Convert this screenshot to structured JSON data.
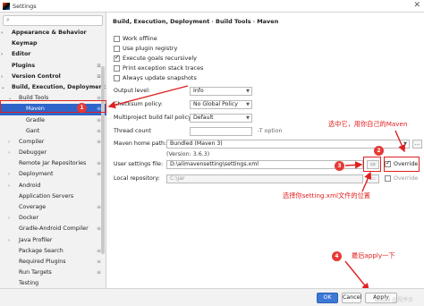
{
  "window": {
    "title": "Settings"
  },
  "search": {
    "placeholder": ""
  },
  "tree": [
    {
      "label": "Appearance & Behavior",
      "bold": true,
      "indent": 0,
      "arrow": "›"
    },
    {
      "label": "Keymap",
      "bold": true,
      "indent": 0,
      "arrow": ""
    },
    {
      "label": "Editor",
      "bold": true,
      "indent": 0,
      "arrow": "›"
    },
    {
      "label": "Plugins",
      "bold": true,
      "indent": 0,
      "arrow": "",
      "cfg": "≡"
    },
    {
      "label": "Version Control",
      "bold": true,
      "indent": 0,
      "arrow": "›",
      "cfg": "≡"
    },
    {
      "label": "Build, Execution, Deployment",
      "bold": true,
      "indent": 0,
      "arrow": "⌄"
    },
    {
      "label": "Build Tools",
      "bold": false,
      "indent": 1,
      "arrow": "⌄",
      "cfg": "≡"
    },
    {
      "label": "Maven",
      "bold": false,
      "indent": 2,
      "arrow": "›",
      "cfg": "≡",
      "selected": true
    },
    {
      "label": "Gradle",
      "bold": false,
      "indent": 2,
      "arrow": "",
      "cfg": "≡"
    },
    {
      "label": "Gant",
      "bold": false,
      "indent": 2,
      "arrow": "",
      "cfg": "≡"
    },
    {
      "label": "Compiler",
      "bold": false,
      "indent": 1,
      "arrow": "›",
      "cfg": "≡"
    },
    {
      "label": "Debugger",
      "bold": false,
      "indent": 1,
      "arrow": "›"
    },
    {
      "label": "Remote Jar Repositories",
      "bold": false,
      "indent": 1,
      "arrow": "",
      "cfg": "≡"
    },
    {
      "label": "Deployment",
      "bold": false,
      "indent": 1,
      "arrow": "›",
      "cfg": "≡"
    },
    {
      "label": "Android",
      "bold": false,
      "indent": 1,
      "arrow": "›"
    },
    {
      "label": "Application Servers",
      "bold": false,
      "indent": 1,
      "arrow": ""
    },
    {
      "label": "Coverage",
      "bold": false,
      "indent": 1,
      "arrow": "",
      "cfg": "≡"
    },
    {
      "label": "Docker",
      "bold": false,
      "indent": 1,
      "arrow": "›"
    },
    {
      "label": "Gradle-Android Compiler",
      "bold": false,
      "indent": 1,
      "arrow": "",
      "cfg": "≡"
    },
    {
      "label": "Java Profiler",
      "bold": false,
      "indent": 1,
      "arrow": "›"
    },
    {
      "label": "Package Search",
      "bold": false,
      "indent": 1,
      "arrow": "",
      "cfg": "≡"
    },
    {
      "label": "Required Plugins",
      "bold": false,
      "indent": 1,
      "arrow": "",
      "cfg": "≡"
    },
    {
      "label": "Run Targets",
      "bold": false,
      "indent": 1,
      "arrow": "",
      "cfg": "≡"
    },
    {
      "label": "Testing",
      "bold": false,
      "indent": 1,
      "arrow": ""
    }
  ],
  "breadcrumb": {
    "part1": "Build, Execution, Deployment",
    "part2": "Build Tools",
    "part3": "Maven",
    "sep": "›"
  },
  "checkboxes": {
    "work_offline": {
      "label": "Work offline",
      "checked": false
    },
    "use_plugin_registry": {
      "label": "Use plugin registry",
      "checked": false
    },
    "execute_goals": {
      "label": "Execute goals recursively",
      "checked": true
    },
    "print_exception": {
      "label": "Print exception stack traces",
      "checked": false
    },
    "always_update": {
      "label": "Always update snapshots",
      "checked": false
    }
  },
  "form": {
    "output_level_label": "Output level:",
    "output_level_value": "Info",
    "checksum_label": "Checksum policy:",
    "checksum_value": "No Global Policy",
    "multiproject_label": "Multiproject build fail policy:",
    "multiproject_value": "Default",
    "thread_count_label": "Thread count",
    "thread_count_value": "",
    "thread_count_hint": "-T option",
    "maven_home_label": "Maven home path:",
    "maven_home_value": "Bundled (Maven 3)",
    "maven_home_browse": "...",
    "maven_version": "(Version: 3.6.3)",
    "user_settings_label": "User settings file:",
    "user_settings_value": "D:\\alimavensetting\\settings.xml",
    "override_label": "Override",
    "local_repo_label": "Local repository:",
    "local_repo_value": "C:\\jar",
    "local_override_label": "Override"
  },
  "annotations": {
    "n1": "1",
    "n2": "2",
    "n3": "3",
    "n4": "4",
    "note_select": "选中它，用你自己的Maven",
    "note_settings": "选择你setting.xml文件的位置",
    "note_apply": "最后apply一下",
    "color": "#e02020"
  },
  "buttons": {
    "ok": "OK",
    "cancel": "Cancel",
    "apply": "Apply"
  },
  "watermark": "CSDN @程序员"
}
